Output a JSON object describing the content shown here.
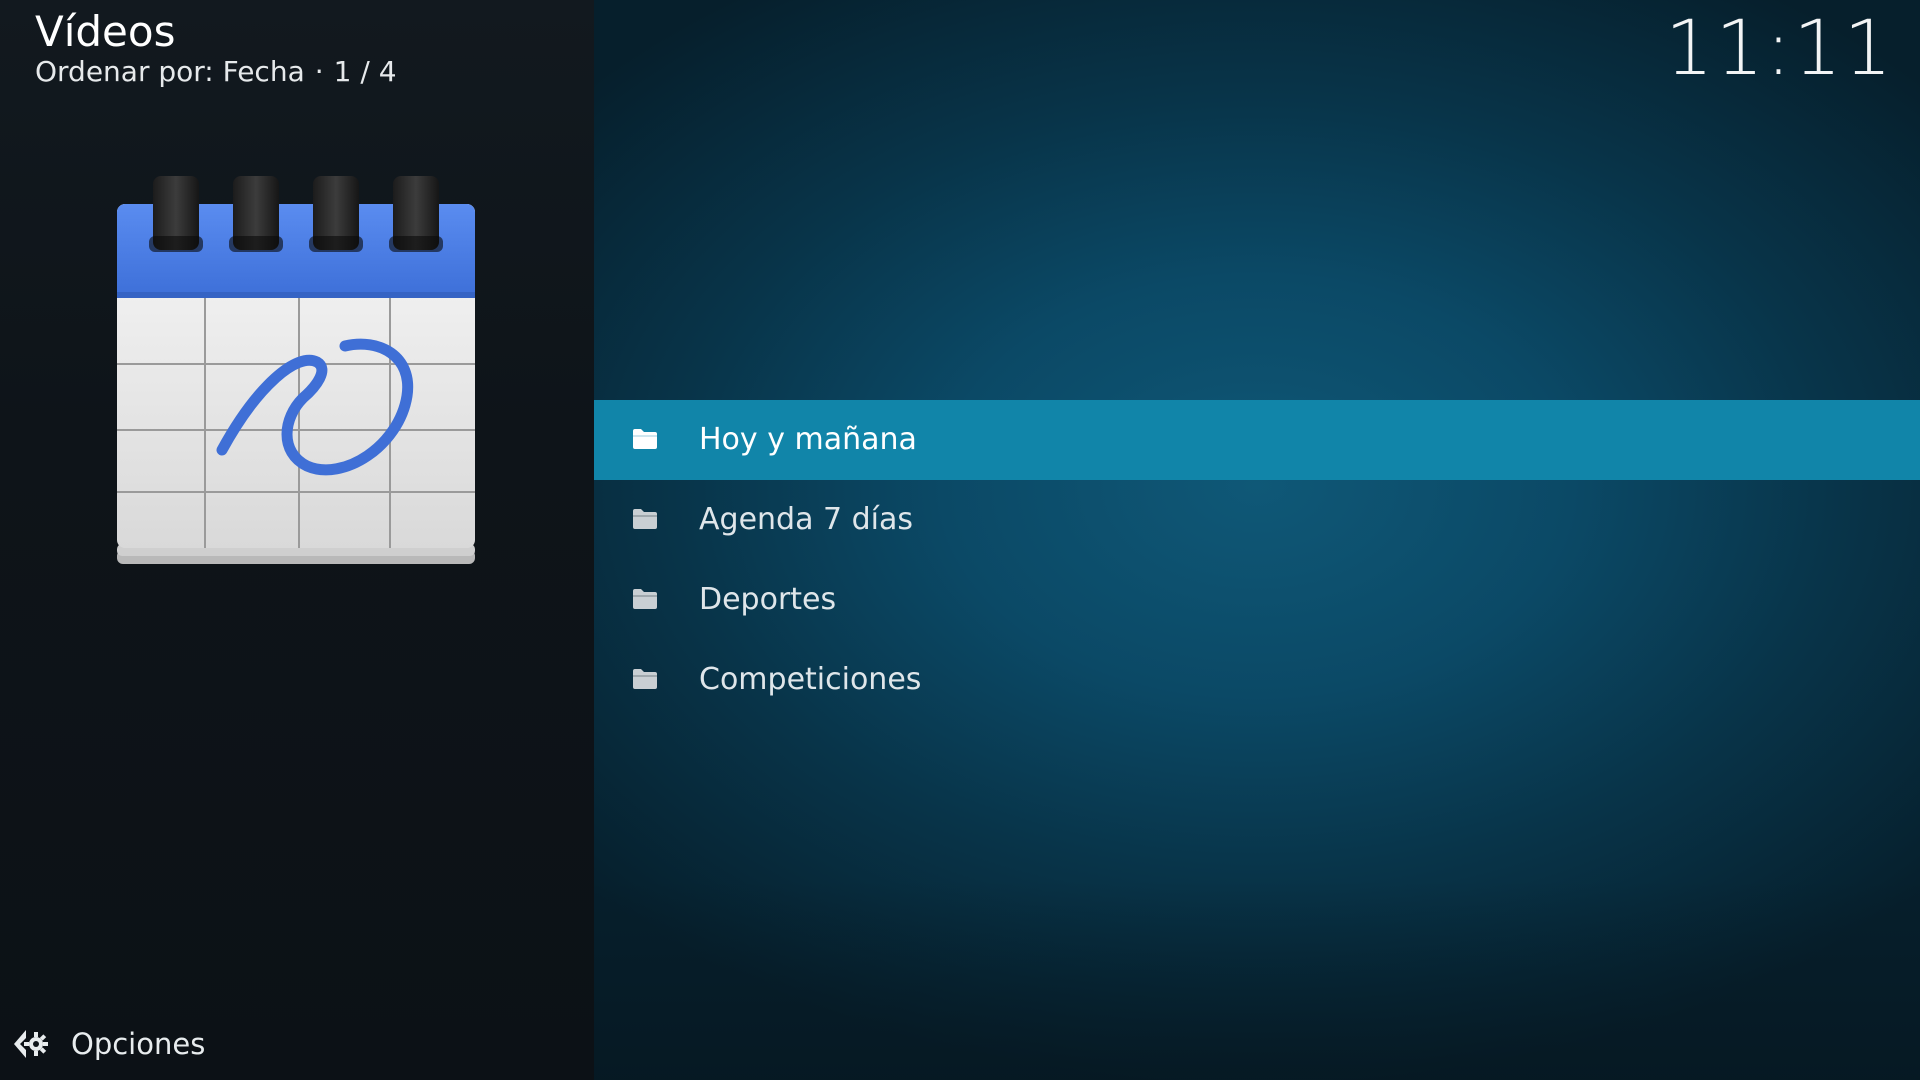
{
  "header": {
    "title": "Vídeos",
    "sort_label": "Ordenar por: Fecha",
    "separator": "·",
    "position": "1 / 4"
  },
  "clock": "11:11",
  "list": {
    "items": [
      {
        "label": "Hoy y mañana",
        "icon": "folder-icon",
        "focused": true
      },
      {
        "label": "Agenda 7 días",
        "icon": "folder-icon",
        "focused": false
      },
      {
        "label": "Deportes",
        "icon": "folder-icon",
        "focused": false
      },
      {
        "label": "Competiciones",
        "icon": "folder-icon",
        "focused": false
      }
    ]
  },
  "footer": {
    "options_label": "Opciones",
    "options_icon": "gear-icon"
  },
  "thumbnail": {
    "icon": "calendar-icon"
  },
  "colors": {
    "focus_highlight": "#1185a9",
    "calendar_header": "#4a7be0",
    "background_teal": "#0b4966"
  }
}
